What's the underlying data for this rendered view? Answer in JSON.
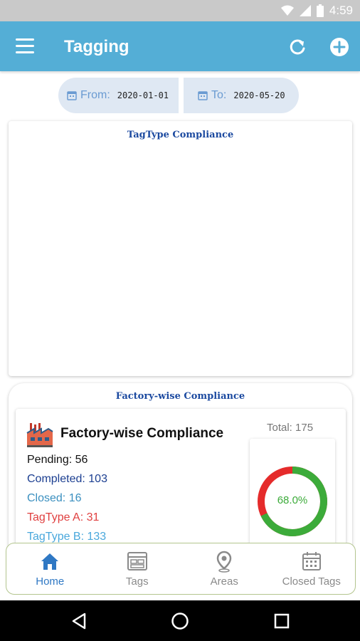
{
  "status_bar": {
    "time": "4:59",
    "icons": [
      "wifi-icon",
      "signal-icon",
      "battery-icon"
    ]
  },
  "app_bar": {
    "title": "Tagging",
    "icons": [
      "menu-icon",
      "refresh-icon",
      "add-icon"
    ]
  },
  "date_filter": {
    "from_label": "From:",
    "from_value": "2020-01-01",
    "to_label": "To:",
    "to_value": "2020-05-20"
  },
  "tagtype_card": {
    "title": "TagType Compliance"
  },
  "factory_card": {
    "title": "Factory-wise Compliance",
    "inner_title": "Factory-wise Compliance",
    "total": "Total: 175",
    "stats": [
      {
        "label": "Pending: 56",
        "color": "#111111"
      },
      {
        "label": "Completed: 103",
        "color": "#1c3f91"
      },
      {
        "label": "Closed: 16",
        "color": "#3a8fbf"
      },
      {
        "label": "TagType A: 31",
        "color": "#e04040"
      },
      {
        "label": "TagType B: 133",
        "color": "#4aa8dc"
      }
    ],
    "gauge": {
      "percent": 68.0,
      "label": "68.0%",
      "fill_color": "#3cab3a",
      "rest_color": "#e52b2b"
    }
  },
  "bottom_nav": {
    "items": [
      {
        "label": "Home",
        "icon": "home-icon",
        "active": true
      },
      {
        "label": "Tags",
        "icon": "tags-icon",
        "active": false
      },
      {
        "label": "Areas",
        "icon": "location-pin-icon",
        "active": false
      },
      {
        "label": "Closed Tags",
        "icon": "calendar-icon",
        "active": false
      }
    ]
  },
  "system_nav": {
    "icons": [
      "back-icon",
      "home-circle-icon",
      "recents-icon"
    ]
  },
  "colors": {
    "app_bar": "#54aed6",
    "accent": "#2f78c4",
    "date_pill": "#dfe8f3"
  }
}
